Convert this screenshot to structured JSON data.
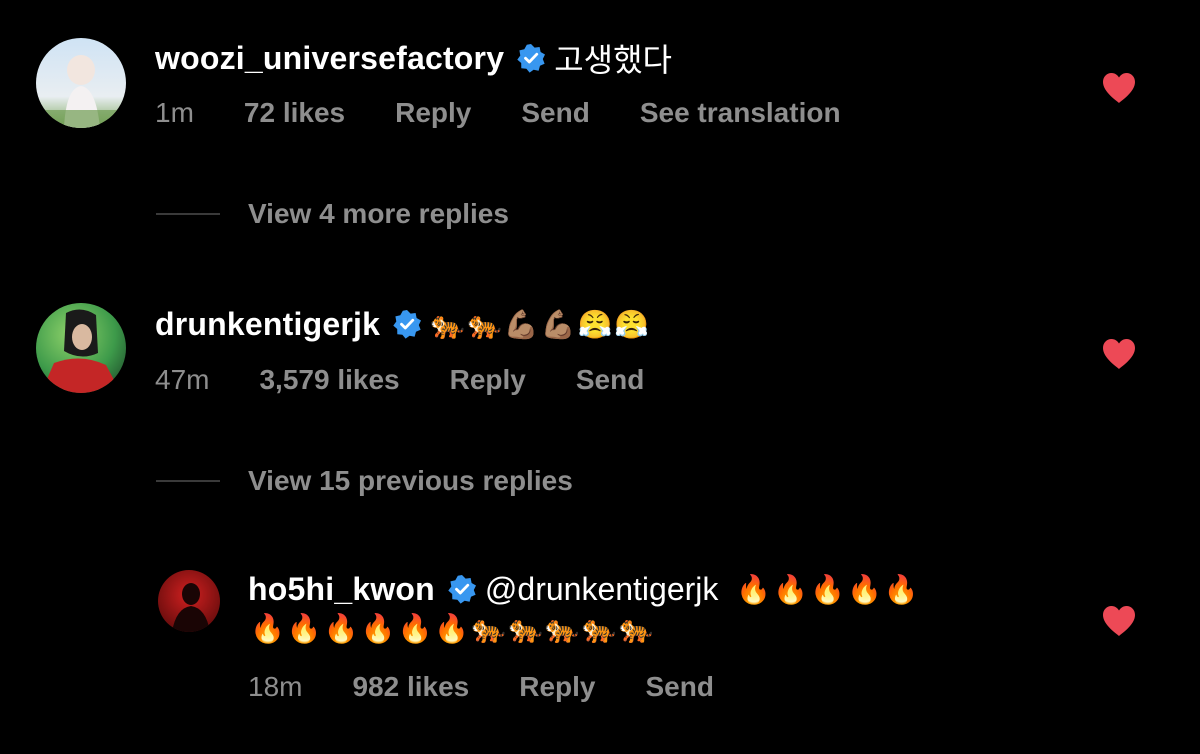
{
  "colors": {
    "background": "#000000",
    "meta_text": "#8e8e8e",
    "heart": "#ed4956",
    "verified": "#3897f0"
  },
  "comments": [
    {
      "username": "woozi_universefactory",
      "verified": true,
      "text": "고생했다",
      "time": "1m",
      "likes": "72 likes",
      "reply": "Reply",
      "send": "Send",
      "translate": "See translation",
      "liked": true
    },
    {
      "username": "drunkentigerjk",
      "verified": true,
      "text": "🐅🐅💪🏽💪🏽😤😤",
      "time": "47m",
      "likes": "3,579 likes",
      "reply": "Reply",
      "send": "Send",
      "liked": true
    },
    {
      "username": "ho5hi_kwon",
      "verified": true,
      "mention": "@drunkentigerjk",
      "text_line1": "🔥🔥🔥🔥🔥",
      "text_line2": "🔥🔥🔥🔥🔥🔥🐅🐅🐅🐅🐅",
      "time": "18m",
      "likes": "982 likes",
      "reply": "Reply",
      "send": "Send",
      "liked": true
    }
  ],
  "threads": [
    {
      "label": "View 4 more replies"
    },
    {
      "label": "View 15 previous replies"
    }
  ]
}
